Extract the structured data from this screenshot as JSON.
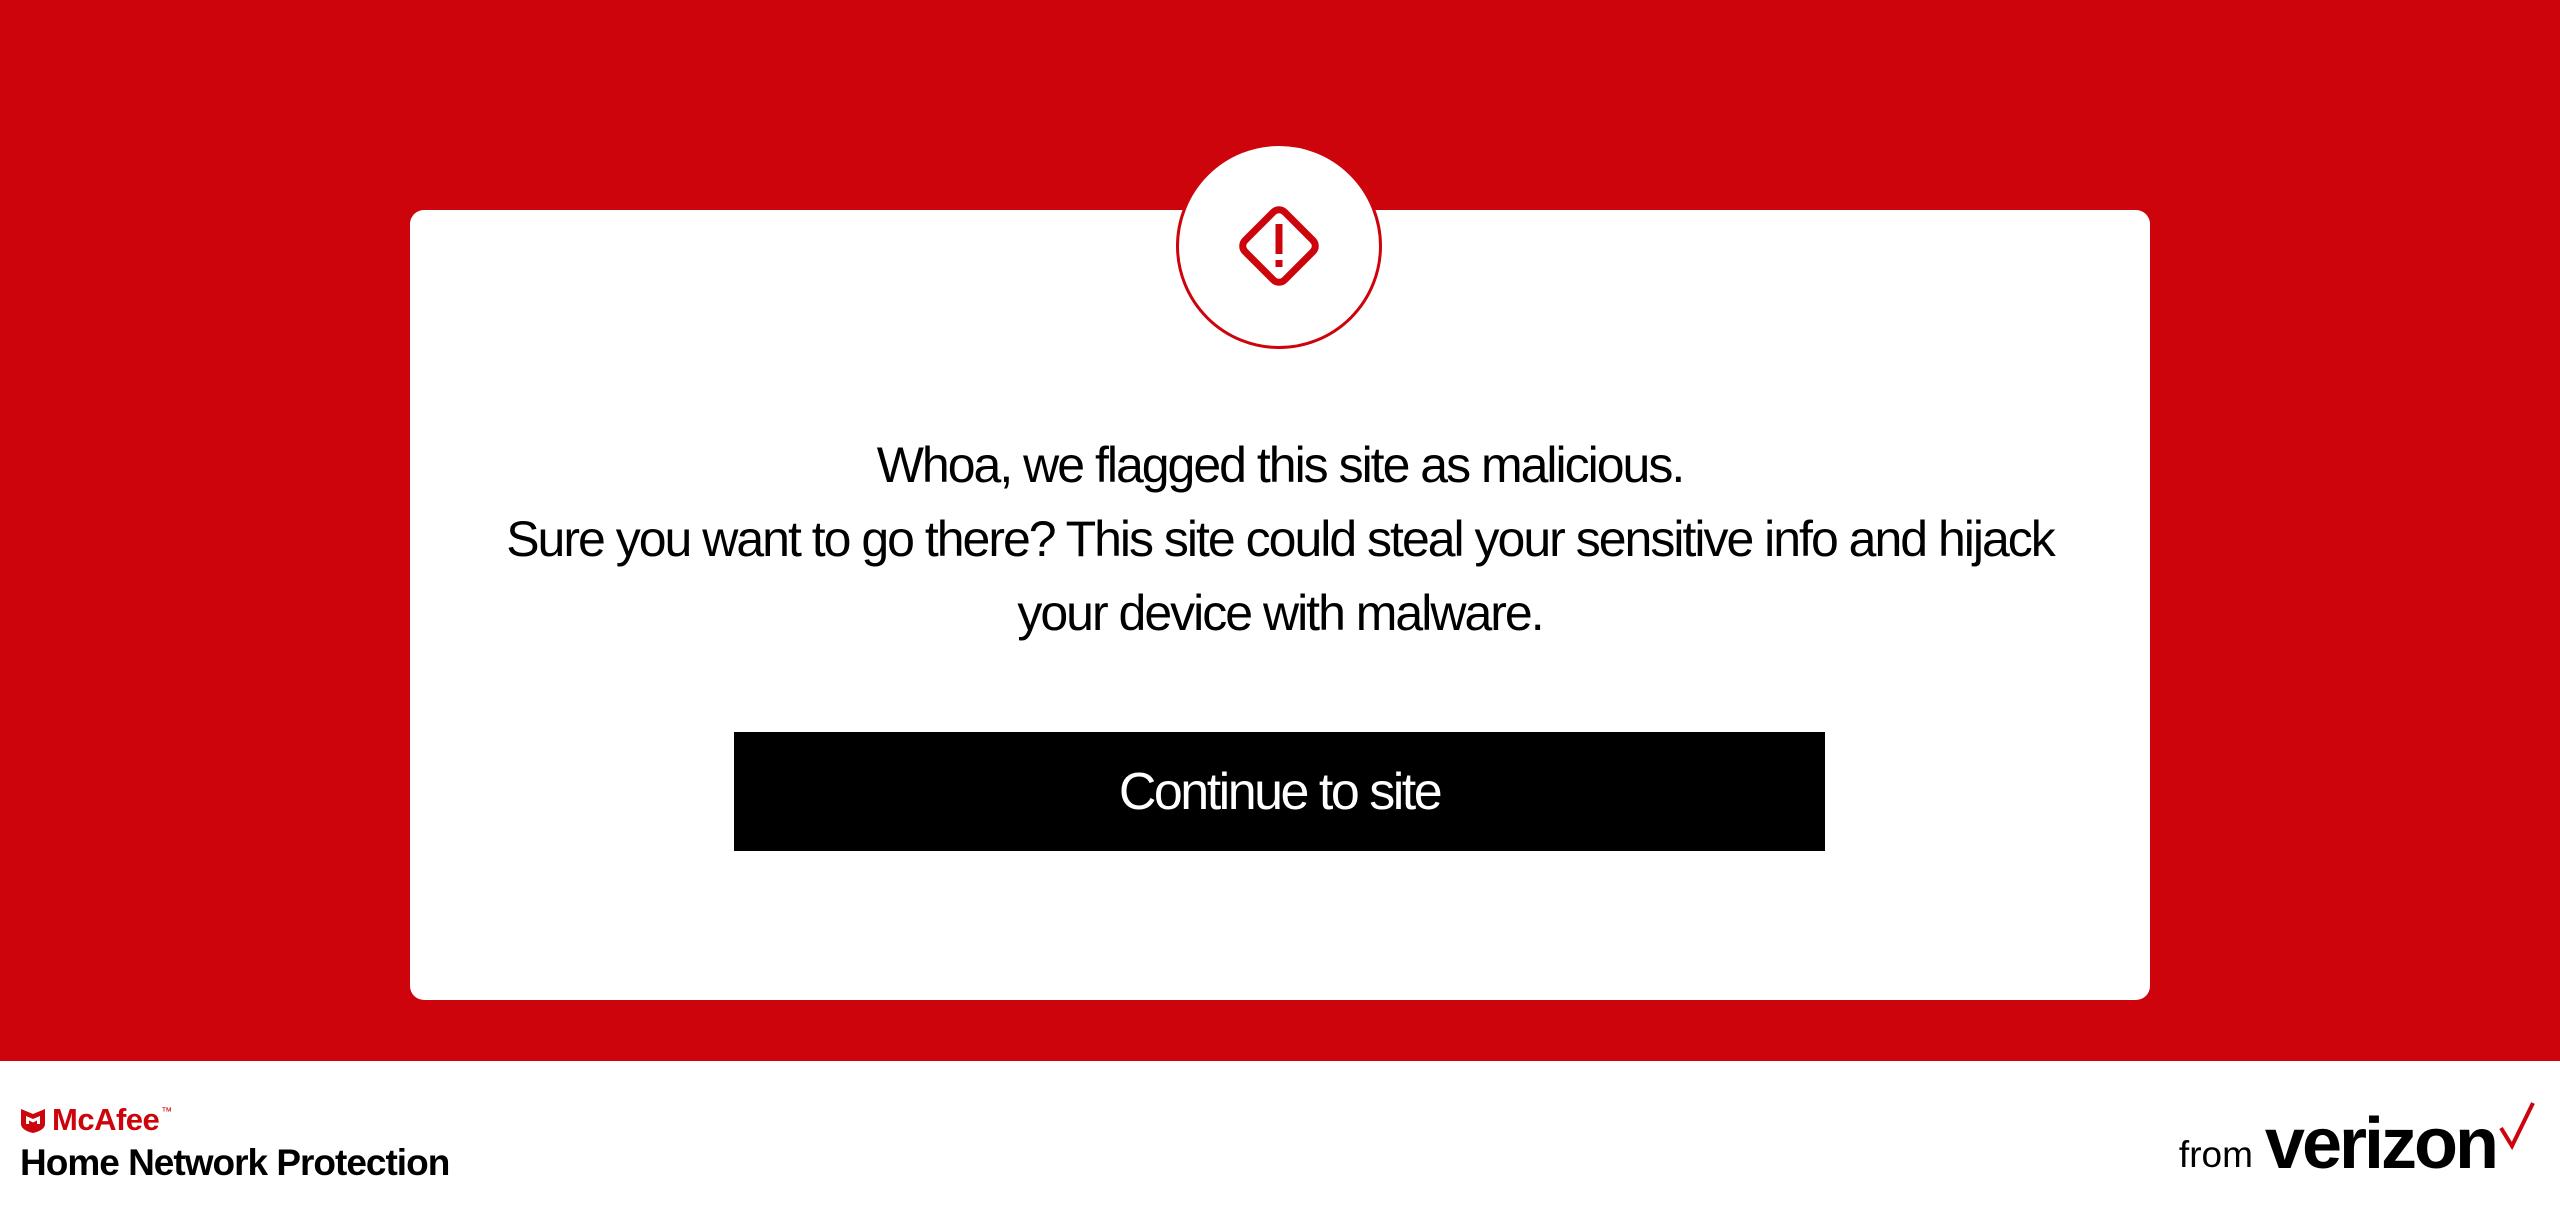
{
  "colors": {
    "banner": "#cd040b",
    "card": "#ffffff",
    "button": "#000000",
    "button_text": "#ffffff",
    "accent": "#cd040b"
  },
  "alert": {
    "icon": "warning-diamond-icon"
  },
  "message": {
    "line1": "Whoa, we flagged this site as malicious.",
    "line2": "Sure you want to go there? This site could steal your sensitive info and hijack",
    "line3": "your device with malware."
  },
  "actions": {
    "continue_label": "Continue to site"
  },
  "footer": {
    "mcafee_icon": "mcafee-shield-icon",
    "mcafee_name": "McAfee",
    "trademark": "™",
    "product_name": "Home Network Protection",
    "from_label": "from",
    "verizon_name": "verizon",
    "verizon_icon": "verizon-check-icon"
  }
}
